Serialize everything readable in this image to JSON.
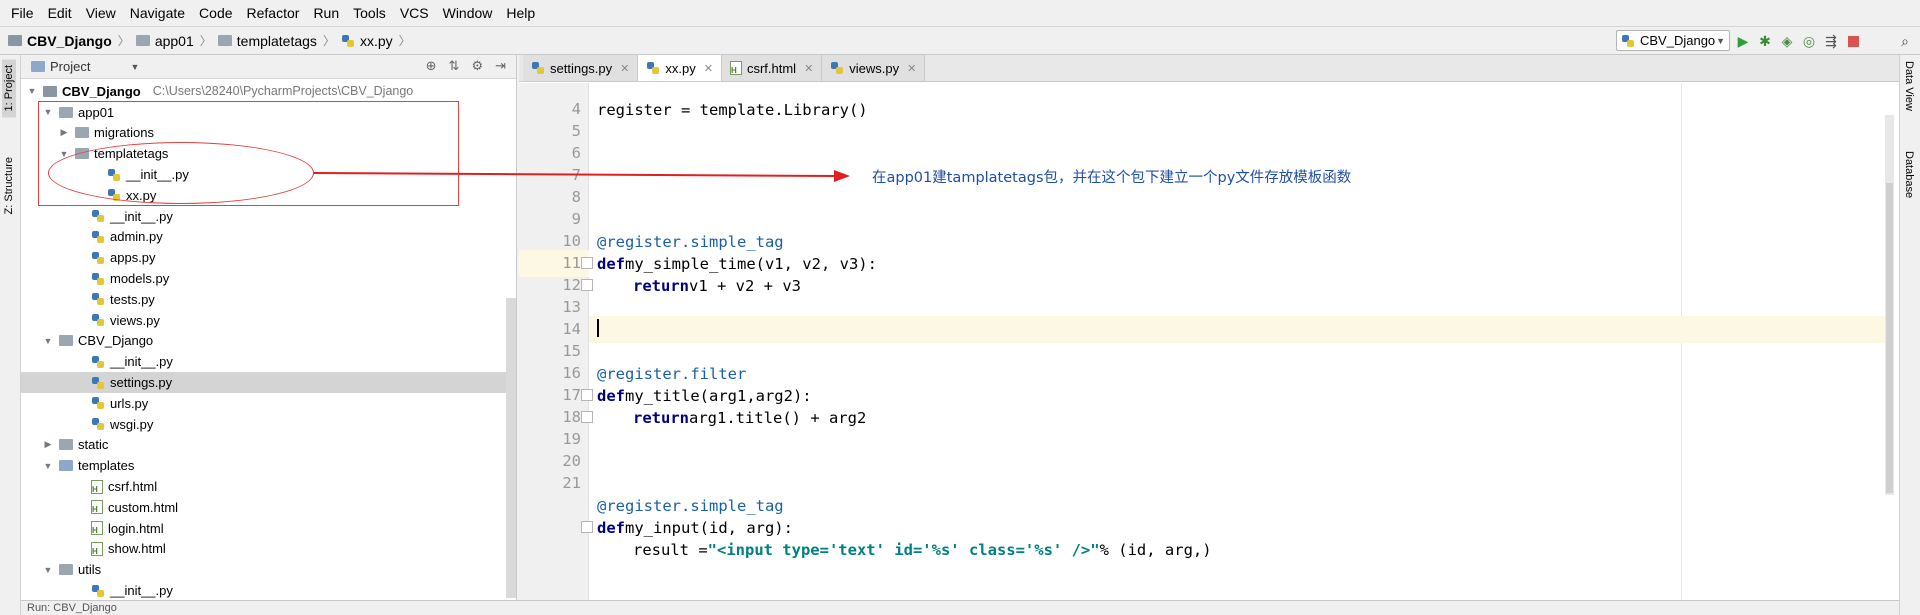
{
  "menu": [
    "File",
    "Edit",
    "View",
    "Navigate",
    "Code",
    "Refactor",
    "Run",
    "Tools",
    "VCS",
    "Window",
    "Help"
  ],
  "breadcrumbs": [
    "CBV_Django",
    "app01",
    "templatetags",
    "xx.py"
  ],
  "run_config": "CBV_Django",
  "left_tabs": {
    "project": "1: Project",
    "structure": "Z: Structure"
  },
  "right_tabs": {
    "data_view": "Data View",
    "database": "Database"
  },
  "project": {
    "title": "Project",
    "root_name": "CBV_Django",
    "root_path": "C:\\Users\\28240\\PycharmProjects\\CBV_Django",
    "items": [
      {
        "label": "app01",
        "type": "folder",
        "arrow": "▼"
      },
      {
        "label": "migrations",
        "type": "folder",
        "arrow": "▶"
      },
      {
        "label": "templatetags",
        "type": "folder",
        "arrow": "▼"
      },
      {
        "label": "__init__.py",
        "type": "py"
      },
      {
        "label": "xx.py",
        "type": "py"
      },
      {
        "label": "__init__.py",
        "type": "py"
      },
      {
        "label": "admin.py",
        "type": "py"
      },
      {
        "label": "apps.py",
        "type": "py"
      },
      {
        "label": "models.py",
        "type": "py"
      },
      {
        "label": "tests.py",
        "type": "py"
      },
      {
        "label": "views.py",
        "type": "py"
      },
      {
        "label": "CBV_Django",
        "type": "folder",
        "arrow": "▼"
      },
      {
        "label": "__init__.py",
        "type": "py"
      },
      {
        "label": "settings.py",
        "type": "py"
      },
      {
        "label": "urls.py",
        "type": "py"
      },
      {
        "label": "wsgi.py",
        "type": "py"
      },
      {
        "label": "static",
        "type": "folder",
        "arrow": "▶"
      },
      {
        "label": "templates",
        "type": "folder",
        "arrow": "▼"
      },
      {
        "label": "csrf.html",
        "type": "html"
      },
      {
        "label": "custom.html",
        "type": "html"
      },
      {
        "label": "login.html",
        "type": "html"
      },
      {
        "label": "show.html",
        "type": "html"
      },
      {
        "label": "utils",
        "type": "folder",
        "arrow": "▼"
      },
      {
        "label": "__init__.py",
        "type": "py"
      }
    ]
  },
  "tabs": [
    {
      "label": "settings.py"
    },
    {
      "label": "xx.py"
    },
    {
      "label": "csrf.html"
    },
    {
      "label": "views.py"
    }
  ],
  "code": {
    "line_numbers": [
      "4",
      "5",
      "6",
      "7",
      "8",
      "9",
      "10",
      "11",
      "12",
      "13",
      "14",
      "15",
      "16",
      "17",
      "18",
      "19",
      "20",
      "21"
    ],
    "l4": "register = template.Library()",
    "l7_dec": "@register.simple_tag",
    "l8_def": "def",
    "l8_rest": " my_simple_time(v1, v2, v3):",
    "l9_ret": "return",
    "l9_rest": " v1 + v2 + v3",
    "l13_dec": "@register.filter",
    "l14_def": "def",
    "l14_rest": " my_title(arg1,arg2):",
    "l15_ret": "return",
    "l15_rest": " arg1.title() + arg2",
    "l19_dec": "@register.simple_tag",
    "l20_def": "def",
    "l20_rest": " my_input(id, arg):",
    "l21_pre": "result = ",
    "l21_str": "\"<input type='text' id='%s' class='%s' />\"",
    "l21_post": " % (id, arg,)"
  },
  "annotation": "在app01建tamplatetags包，并在这个包下建立一个py文件存放模板函数",
  "bottom": "Run: CBV_Django"
}
